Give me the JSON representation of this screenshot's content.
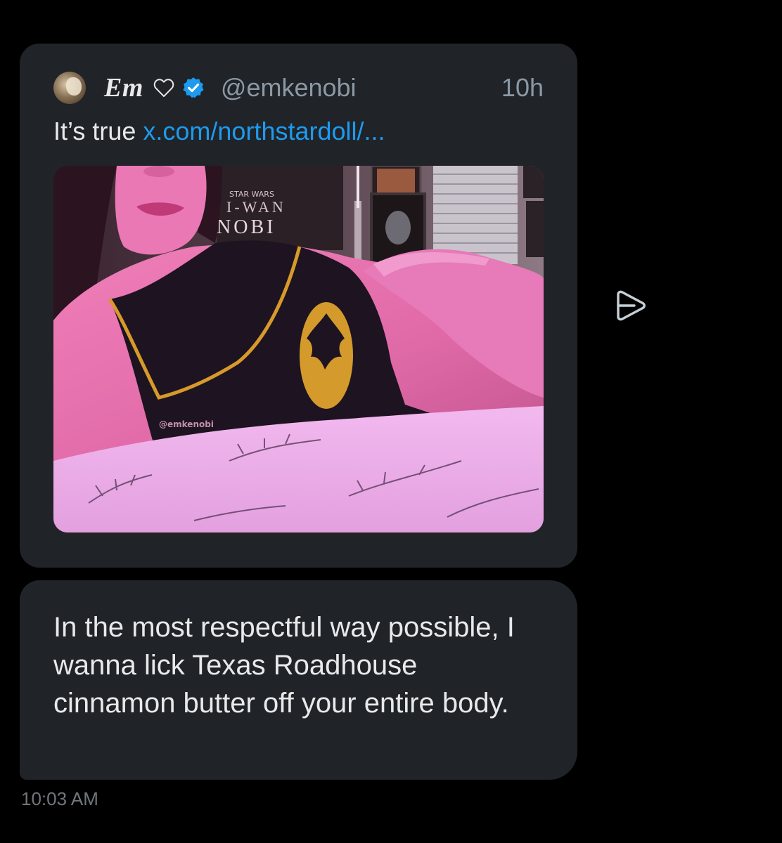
{
  "quoted_post": {
    "display_name": "Em",
    "handle": "@emkenobi",
    "time_ago": "10h",
    "text_prefix": "It’s true ",
    "link_text": "x.com/northstardoll/...",
    "image_watermark": "@emkenobi",
    "poster_text_top": "STAR WARS",
    "poster_text_mid": "I-WAN",
    "poster_text_bottom": "NOBI"
  },
  "message": {
    "text": "In the most respectful way possible, I wanna lick Texas Roadhouse cinnamon butter off your entire body.",
    "timestamp": "10:03 AM"
  },
  "icons": {
    "heart": "heart-outline-icon",
    "verified": "verified-badge-icon",
    "share": "share-icon"
  },
  "colors": {
    "background": "#000000",
    "bubble": "#202327",
    "link": "#1d9bf0",
    "verified": "#1d9bf0",
    "secondary_text": "#8b98a5"
  }
}
